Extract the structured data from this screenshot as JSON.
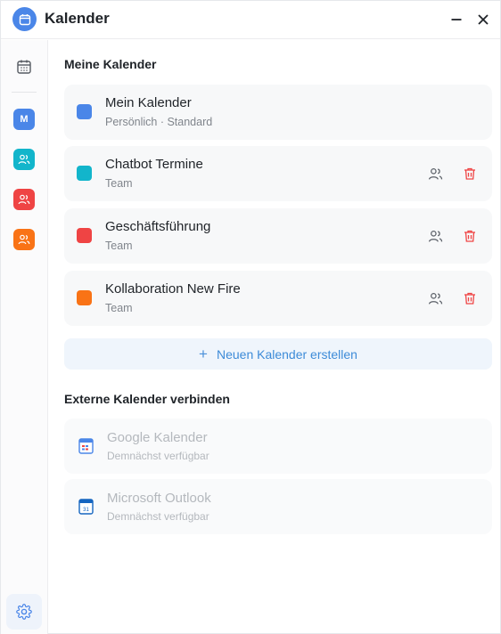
{
  "window": {
    "title": "Kalender",
    "icons": {
      "app": "calendar-icon",
      "minimize": "minimize-icon",
      "close": "close-icon"
    }
  },
  "sidebar": {
    "items": [
      {
        "name": "calendar",
        "icon": "calendar-icon"
      },
      {
        "name": "mein-kalender",
        "letter": "M",
        "color": "#4a86e8"
      },
      {
        "name": "chatbot-termine",
        "icon": "team-icon",
        "color": "#12b5cb"
      },
      {
        "name": "geschaeftsfuehrung",
        "icon": "team-icon",
        "color": "#ef4444"
      },
      {
        "name": "kollaboration-new-fire",
        "icon": "team-icon",
        "color": "#f97316"
      }
    ],
    "settings_icon": "gear-icon"
  },
  "main": {
    "my_calendars_title": "Meine Kalender",
    "calendars": [
      {
        "title": "Mein Kalender",
        "subtitle": "Persönlich · Standard",
        "color": "#4a86e8",
        "actions": false
      },
      {
        "title": "Chatbot Termine",
        "subtitle": "Team",
        "color": "#12b5cb",
        "actions": true
      },
      {
        "title": "Geschäftsführung",
        "subtitle": "Team",
        "color": "#ef4444",
        "actions": true
      },
      {
        "title": "Kollaboration New Fire",
        "subtitle": "Team",
        "color": "#f97316",
        "actions": true
      }
    ],
    "new_calendar_label": "Neuen Kalender erstellen",
    "external_title": "Externe Kalender verbinden",
    "external": [
      {
        "title": "Google Kalender",
        "subtitle": "Demnächst verfügbar",
        "icon": "google-calendar-icon"
      },
      {
        "title": "Microsoft Outlook",
        "subtitle": "Demnächst verfügbar",
        "icon": "outlook-calendar-icon"
      }
    ]
  },
  "colors": {
    "accent": "#4a86e8",
    "danger": "#ef4444",
    "link": "#3d8bd8"
  }
}
